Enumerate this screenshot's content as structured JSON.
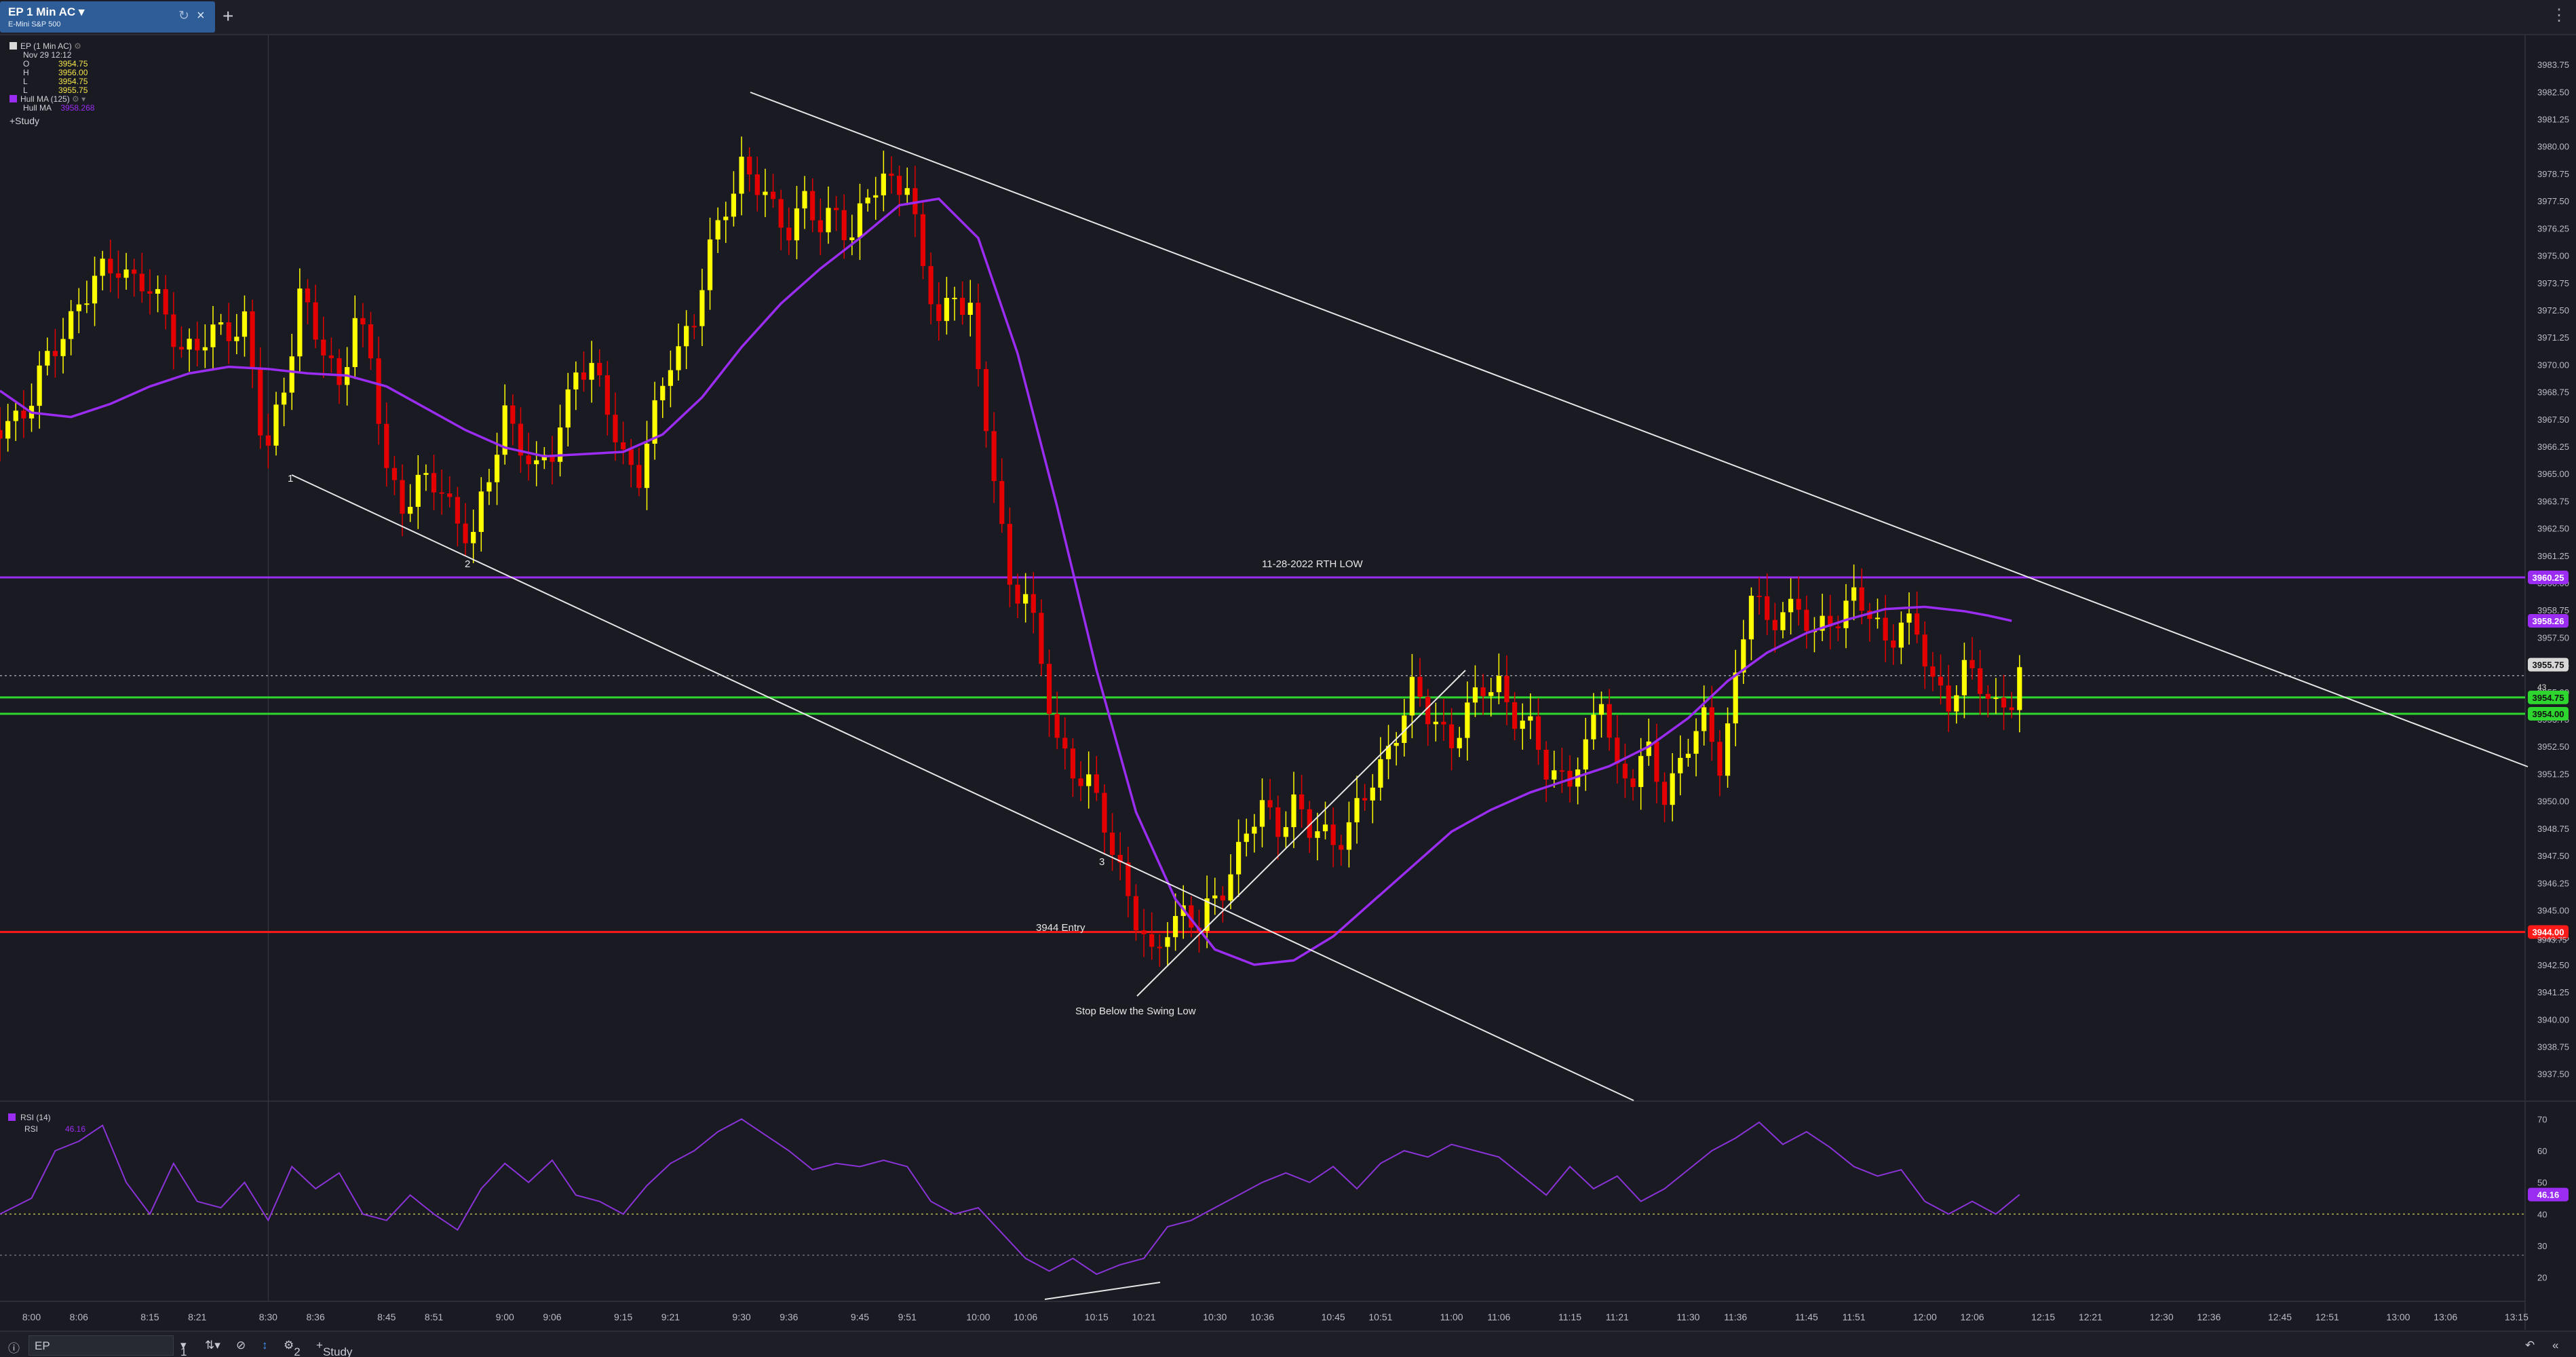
{
  "tab": {
    "title": "EP 1 Min AC",
    "subtitle": "E-Mini S&P 500",
    "close_icon": "close-icon",
    "refresh_icon": "refresh-icon"
  },
  "legend": {
    "symbol_line": "EP (1 Min AC)",
    "date": "Nov 29 12:12",
    "ohlc": [
      {
        "k": "O",
        "v": "3954.75"
      },
      {
        "k": "H",
        "v": "3956.00"
      },
      {
        "k": "L",
        "v": "3954.75"
      },
      {
        "k": "L",
        "v": "3955.75"
      }
    ],
    "hull_title": "Hull MA (125)",
    "hull_name": "Hull MA",
    "hull_value": "3958.268",
    "study_button": "+Study",
    "rsi_title": "RSI (14)",
    "rsi_name": "RSI",
    "rsi_value": "46.16"
  },
  "colors": {
    "background": "#1a1a22",
    "up": "#ffff00",
    "down": "#e50000",
    "hull": "#9b2cf2",
    "rth_line": "#9b2cf2",
    "entry_line": "#ff1a1a",
    "green_lines": "#2fd52f",
    "trendline": "#e6e6e6"
  },
  "annotations": {
    "rth_low": "11-28-2022 RTH LOW",
    "entry": "3944 Entry",
    "stop": "Stop Below the Swing Low",
    "point1": "1",
    "point2": "2",
    "point3": "3"
  },
  "price_badges": {
    "rth": "3960.25",
    "hull": "3958.26",
    "last": "3955.75",
    "countdown": "43",
    "green1": "3954.75",
    "green2": "3954.00",
    "entry": "3944.00",
    "entry_under": "3943.75",
    "rsi": "46.16"
  },
  "bottom": {
    "symbol": "EP",
    "interval": "1",
    "alerts": "2",
    "study": "Study"
  },
  "chart_data": {
    "type": "candlestick",
    "y_ticks": [
      "3983.75",
      "3982.50",
      "3981.25",
      "3980.00",
      "3978.75",
      "3977.50",
      "3976.25",
      "3975.00",
      "3973.75",
      "3972.50",
      "3971.25",
      "3970.00",
      "3968.75",
      "3967.50",
      "3966.25",
      "3965.00",
      "3963.75",
      "3962.50",
      "3961.25",
      "3960.00",
      "3958.75",
      "3957.50",
      "3956.25",
      "3955.00",
      "3953.75",
      "3952.50",
      "3951.25",
      "3950.00",
      "3948.75",
      "3947.50",
      "3946.25",
      "3945.00",
      "3943.75",
      "3942.50",
      "3941.25",
      "3940.00",
      "3938.75",
      "3937.50"
    ],
    "x_ticks": [
      "8:00",
      "8:06",
      "8:15",
      "8:21",
      "8:30",
      "8:36",
      "8:45",
      "8:51",
      "9:00",
      "9:06",
      "9:15",
      "9:21",
      "9:30",
      "9:36",
      "9:45",
      "9:51",
      "10:00",
      "10:06",
      "10:15",
      "10:21",
      "10:30",
      "10:36",
      "10:45",
      "10:51",
      "11:00",
      "11:06",
      "11:15",
      "11:21",
      "11:30",
      "11:36",
      "11:45",
      "11:51",
      "12:00",
      "12:06",
      "12:15",
      "12:21",
      "12:30",
      "12:36",
      "12:45",
      "12:51",
      "13:00",
      "13:06",
      "13:15"
    ],
    "x_range": [
      "7:56",
      "13:16"
    ],
    "ylim": [
      3936.9,
      3984.5
    ],
    "levels": {
      "rth_low": 3960.25,
      "green1": 3954.75,
      "green2": 3954.0,
      "entry": 3944.0,
      "dotted_last": 3955.75
    },
    "price_path": [
      [
        "7:56",
        3967.0
      ],
      [
        "8:00",
        3968.5
      ],
      [
        "8:04",
        3971.5
      ],
      [
        "8:06",
        3973.0
      ],
      [
        "8:09",
        3974.0
      ],
      [
        "8:11",
        3974.6
      ],
      [
        "8:14",
        3973.8
      ],
      [
        "8:16",
        3972.6
      ],
      [
        "8:19",
        3971.0
      ],
      [
        "8:21",
        3970.8
      ],
      [
        "8:24",
        3971.4
      ],
      [
        "8:27",
        3972.2
      ],
      [
        "8:29",
        3967.0
      ],
      [
        "8:30",
        3966.0
      ],
      [
        "8:32",
        3969.0
      ],
      [
        "8:34",
        3973.5
      ],
      [
        "8:36",
        3971.2
      ],
      [
        "8:39",
        3969.0
      ],
      [
        "8:41",
        3972.5
      ],
      [
        "8:43",
        3970.0
      ],
      [
        "8:45",
        3965.0
      ],
      [
        "8:47",
        3963.8
      ],
      [
        "8:49",
        3964.5
      ],
      [
        "8:52",
        3964.2
      ],
      [
        "8:54",
        3963.0
      ],
      [
        "8:56",
        3962.2
      ],
      [
        "8:58",
        3964.5
      ],
      [
        "9:00",
        3968.0
      ],
      [
        "9:02",
        3966.5
      ],
      [
        "9:04",
        3964.8
      ],
      [
        "9:06",
        3966.0
      ],
      [
        "9:09",
        3970.0
      ],
      [
        "9:11",
        3969.5
      ],
      [
        "9:13",
        3968.0
      ],
      [
        "9:15",
        3966.0
      ],
      [
        "9:17",
        3964.8
      ],
      [
        "9:19",
        3967.5
      ],
      [
        "9:21",
        3970.5
      ],
      [
        "9:24",
        3972.0
      ],
      [
        "9:26",
        3975.0
      ],
      [
        "9:28",
        3977.5
      ],
      [
        "9:30",
        3979.2
      ],
      [
        "9:32",
        3978.0
      ],
      [
        "9:34",
        3977.0
      ],
      [
        "9:36",
        3976.5
      ],
      [
        "9:38",
        3977.5
      ],
      [
        "9:40",
        3976.0
      ],
      [
        "9:42",
        3977.2
      ],
      [
        "9:44",
        3976.0
      ],
      [
        "9:46",
        3977.5
      ],
      [
        "9:48",
        3978.4
      ],
      [
        "9:51",
        3978.6
      ],
      [
        "9:53",
        3974.0
      ],
      [
        "9:55",
        3972.0
      ],
      [
        "9:57",
        3973.5
      ],
      [
        "9:59",
        3972.5
      ],
      [
        "10:00",
        3969.0
      ],
      [
        "10:02",
        3965.0
      ],
      [
        "10:04",
        3960.0
      ],
      [
        "10:06",
        3959.5
      ],
      [
        "10:08",
        3956.0
      ],
      [
        "10:10",
        3953.0
      ],
      [
        "10:12",
        3951.5
      ],
      [
        "10:14",
        3950.5
      ],
      [
        "10:16",
        3949.0
      ],
      [
        "10:18",
        3947.0
      ],
      [
        "10:20",
        3944.5
      ],
      [
        "10:22",
        3942.5
      ],
      [
        "10:24",
        3944.5
      ],
      [
        "10:26",
        3945.0
      ],
      [
        "10:28",
        3944.0
      ],
      [
        "10:30",
        3945.5
      ],
      [
        "10:32",
        3947.0
      ],
      [
        "10:34",
        3948.5
      ],
      [
        "10:36",
        3949.5
      ],
      [
        "10:38",
        3949.0
      ],
      [
        "10:40",
        3950.0
      ],
      [
        "10:42",
        3948.5
      ],
      [
        "10:45",
        3948.3
      ],
      [
        "10:47",
        3949.0
      ],
      [
        "10:49",
        3950.0
      ],
      [
        "10:51",
        3951.5
      ],
      [
        "10:53",
        3953.5
      ],
      [
        "10:55",
        3955.0
      ],
      [
        "10:57",
        3953.8
      ],
      [
        "11:00",
        3953.0
      ],
      [
        "11:02",
        3954.0
      ],
      [
        "11:04",
        3955.0
      ],
      [
        "11:06",
        3955.5
      ],
      [
        "11:08",
        3954.0
      ],
      [
        "11:10",
        3953.0
      ],
      [
        "11:12",
        3951.5
      ],
      [
        "11:15",
        3951.2
      ],
      [
        "11:17",
        3952.0
      ],
      [
        "11:19",
        3955.0
      ],
      [
        "11:21",
        3951.5
      ],
      [
        "11:23",
        3951.0
      ],
      [
        "11:25",
        3952.0
      ],
      [
        "11:27",
        3950.5
      ],
      [
        "11:30",
        3952.5
      ],
      [
        "11:32",
        3953.5
      ],
      [
        "11:34",
        3952.0
      ],
      [
        "11:36",
        3955.5
      ],
      [
        "11:38",
        3959.5
      ],
      [
        "11:40",
        3958.0
      ],
      [
        "11:42",
        3959.2
      ],
      [
        "11:44",
        3958.5
      ],
      [
        "11:46",
        3957.5
      ],
      [
        "11:48",
        3958.5
      ],
      [
        "11:51",
        3959.2
      ],
      [
        "11:53",
        3958.4
      ],
      [
        "11:55",
        3957.5
      ],
      [
        "11:57",
        3958.3
      ],
      [
        "11:59",
        3957.4
      ],
      [
        "12:01",
        3955.5
      ],
      [
        "12:03",
        3954.8
      ],
      [
        "12:05",
        3955.8
      ],
      [
        "12:07",
        3955.2
      ],
      [
        "12:09",
        3954.5
      ],
      [
        "12:11",
        3954.8
      ],
      [
        "12:12",
        3955.75
      ]
    ],
    "hull_ma": [
      [
        "7:56",
        3968.8
      ],
      [
        "8:00",
        3967.8
      ],
      [
        "8:05",
        3967.6
      ],
      [
        "8:10",
        3968.2
      ],
      [
        "8:15",
        3969.0
      ],
      [
        "8:20",
        3969.6
      ],
      [
        "8:25",
        3969.9
      ],
      [
        "8:30",
        3969.8
      ],
      [
        "8:35",
        3969.6
      ],
      [
        "8:40",
        3969.5
      ],
      [
        "8:45",
        3969.0
      ],
      [
        "8:50",
        3968.0
      ],
      [
        "8:55",
        3967.0
      ],
      [
        "9:00",
        3966.2
      ],
      [
        "9:05",
        3965.8
      ],
      [
        "9:10",
        3965.9
      ],
      [
        "9:15",
        3966.0
      ],
      [
        "9:20",
        3966.8
      ],
      [
        "9:25",
        3968.5
      ],
      [
        "9:30",
        3970.8
      ],
      [
        "9:35",
        3972.8
      ],
      [
        "9:40",
        3974.4
      ],
      [
        "9:45",
        3975.8
      ],
      [
        "9:50",
        3977.3
      ],
      [
        "9:55",
        3977.6
      ],
      [
        "10:00",
        3975.8
      ],
      [
        "10:05",
        3970.5
      ],
      [
        "10:10",
        3963.5
      ],
      [
        "10:15",
        3956.0
      ],
      [
        "10:20",
        3949.5
      ],
      [
        "10:25",
        3945.5
      ],
      [
        "10:30",
        3943.2
      ],
      [
        "10:35",
        3942.5
      ],
      [
        "10:40",
        3942.7
      ],
      [
        "10:45",
        3943.8
      ],
      [
        "10:50",
        3945.4
      ],
      [
        "10:55",
        3947.0
      ],
      [
        "11:00",
        3948.6
      ],
      [
        "11:05",
        3949.6
      ],
      [
        "11:10",
        3950.4
      ],
      [
        "11:15",
        3951.0
      ],
      [
        "11:20",
        3951.6
      ],
      [
        "11:25",
        3952.5
      ],
      [
        "11:30",
        3953.8
      ],
      [
        "11:35",
        3955.5
      ],
      [
        "11:40",
        3956.8
      ],
      [
        "11:45",
        3957.7
      ],
      [
        "11:50",
        3958.3
      ],
      [
        "11:55",
        3958.8
      ],
      [
        "12:00",
        3958.9
      ],
      [
        "12:05",
        3958.7
      ],
      [
        "12:08",
        3958.5
      ],
      [
        "12:11",
        3958.26
      ]
    ],
    "rsi": {
      "ylim": [
        18,
        72
      ],
      "y_ticks": [
        "70",
        "60",
        "50",
        "40",
        "30",
        "20"
      ],
      "dotted_levels": [
        40,
        27
      ],
      "series": [
        [
          "7:56",
          40
        ],
        [
          "8:00",
          45
        ],
        [
          "8:03",
          60
        ],
        [
          "8:06",
          63
        ],
        [
          "8:09",
          68
        ],
        [
          "8:12",
          50
        ],
        [
          "8:15",
          40
        ],
        [
          "8:18",
          56
        ],
        [
          "8:21",
          44
        ],
        [
          "8:24",
          42
        ],
        [
          "8:27",
          50
        ],
        [
          "8:30",
          38
        ],
        [
          "8:33",
          55
        ],
        [
          "8:36",
          48
        ],
        [
          "8:39",
          53
        ],
        [
          "8:42",
          40
        ],
        [
          "8:45",
          38
        ],
        [
          "8:48",
          46
        ],
        [
          "8:51",
          40
        ],
        [
          "8:54",
          35
        ],
        [
          "8:57",
          48
        ],
        [
          "9:00",
          56
        ],
        [
          "9:03",
          50
        ],
        [
          "9:06",
          57
        ],
        [
          "9:09",
          46
        ],
        [
          "9:12",
          44
        ],
        [
          "9:15",
          40
        ],
        [
          "9:18",
          49
        ],
        [
          "9:21",
          56
        ],
        [
          "9:24",
          60
        ],
        [
          "9:27",
          66
        ],
        [
          "9:30",
          70
        ],
        [
          "9:33",
          65
        ],
        [
          "9:36",
          60
        ],
        [
          "9:39",
          54
        ],
        [
          "9:42",
          56
        ],
        [
          "9:45",
          55
        ],
        [
          "9:48",
          57
        ],
        [
          "9:51",
          55
        ],
        [
          "9:54",
          44
        ],
        [
          "9:57",
          40
        ],
        [
          "10:00",
          42
        ],
        [
          "10:03",
          34
        ],
        [
          "10:06",
          26
        ],
        [
          "10:09",
          22
        ],
        [
          "10:12",
          26
        ],
        [
          "10:15",
          21
        ],
        [
          "10:18",
          24
        ],
        [
          "10:21",
          26
        ],
        [
          "10:24",
          36
        ],
        [
          "10:27",
          38
        ],
        [
          "10:30",
          42
        ],
        [
          "10:33",
          46
        ],
        [
          "10:36",
          50
        ],
        [
          "10:39",
          53
        ],
        [
          "10:42",
          50
        ],
        [
          "10:45",
          55
        ],
        [
          "10:48",
          48
        ],
        [
          "10:51",
          56
        ],
        [
          "10:54",
          60
        ],
        [
          "10:57",
          58
        ],
        [
          "11:00",
          62
        ],
        [
          "11:03",
          60
        ],
        [
          "11:06",
          58
        ],
        [
          "11:09",
          52
        ],
        [
          "11:12",
          46
        ],
        [
          "11:15",
          55
        ],
        [
          "11:18",
          48
        ],
        [
          "11:21",
          52
        ],
        [
          "11:24",
          44
        ],
        [
          "11:27",
          48
        ],
        [
          "11:30",
          54
        ],
        [
          "11:33",
          60
        ],
        [
          "11:36",
          64
        ],
        [
          "11:39",
          69
        ],
        [
          "11:42",
          62
        ],
        [
          "11:45",
          66
        ],
        [
          "11:48",
          61
        ],
        [
          "11:51",
          55
        ],
        [
          "11:54",
          52
        ],
        [
          "11:57",
          54
        ],
        [
          "12:00",
          44
        ],
        [
          "12:03",
          40
        ],
        [
          "12:06",
          44
        ],
        [
          "12:09",
          40
        ],
        [
          "12:12",
          46.16
        ]
      ]
    }
  }
}
